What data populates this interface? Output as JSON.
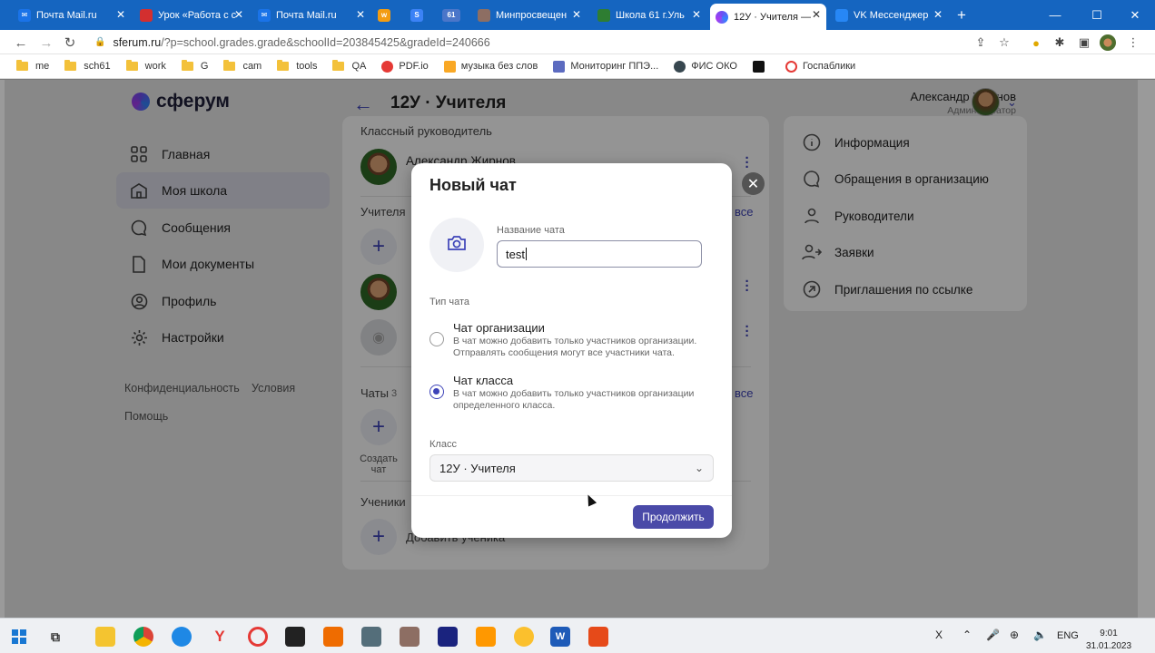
{
  "browser": {
    "tabs": [
      {
        "label": "Почта Mail.ru",
        "icon": "mail-icon"
      },
      {
        "label": "Урок «Работа с с",
        "icon": "youtube-icon"
      },
      {
        "label": "Почта Mail.ru",
        "icon": "mail-icon"
      },
      {
        "label": "w",
        "icon": "w-app-icon"
      },
      {
        "label": "S",
        "icon": "s-app-icon"
      },
      {
        "label": "61",
        "icon": "school61-icon"
      },
      {
        "label": "Минпросвещен",
        "icon": "ministry-icon"
      },
      {
        "label": "Школа 61 г.Уль",
        "icon": "school-icon"
      },
      {
        "label": "12У · Учителя —",
        "icon": "sferum-icon"
      },
      {
        "label": "VK Мессенджер",
        "icon": "vk-icon"
      }
    ],
    "url_host": "sferum.ru",
    "url_path": "/?p=school.grades.grade&schoolId=203845425&gradeId=240666",
    "bookmarks": [
      "me",
      "sch61",
      "work",
      "G",
      "cam",
      "tools",
      "QA",
      "PDF.io",
      "музыка без слов",
      "Мониторинг ППЭ...",
      "ФИС ОКО",
      "Госпаблики"
    ]
  },
  "app": {
    "logo": "сферум",
    "header_title": "12У · Учителя",
    "user_name": "Александр Жирнов",
    "user_role": "Администратор",
    "sidebar": [
      "Главная",
      "Моя школа",
      "Сообщения",
      "Мои документы",
      "Профиль",
      "Настройки"
    ],
    "footer_links": [
      "Конфиденциальность",
      "Условия",
      "Помощь"
    ],
    "main": {
      "class_teacher_heading": "Классный руководитель",
      "class_teacher_name": "Александр Жирнов",
      "teachers_heading": "Учителя",
      "see_all": "все",
      "chats_heading": "Чаты",
      "chats_count": "3",
      "create_chat": "Создать чат",
      "students_heading": "Ученики",
      "add_student": "Добавить ученика"
    },
    "right_menu": [
      "Информация",
      "Обращения в организацию",
      "Руководители",
      "Заявки",
      "Приглашения по ссылке"
    ]
  },
  "modal": {
    "title": "Новый чат",
    "name_label": "Название чата",
    "name_value": "test",
    "type_label": "Тип чата",
    "option1_title": "Чат организации",
    "option1_desc": "В чат можно добавить только участников организации. Отправлять сообщения могут все участники чата.",
    "option2_title": "Чат класса",
    "option2_desc": "В чат можно добавить только участников организации определенного класса.",
    "selected_option": "Чат класса",
    "class_label": "Класс",
    "class_value": "12У · Учителя",
    "continue_button": "Продолжить"
  },
  "taskbar": {
    "lang": "ENG",
    "time": "9:01",
    "date": "31.01.2023",
    "tray_x": "X"
  },
  "colors": {
    "accent": "#3d43b8",
    "tabbar": "#1565c0",
    "button": "#4a4aa8"
  }
}
